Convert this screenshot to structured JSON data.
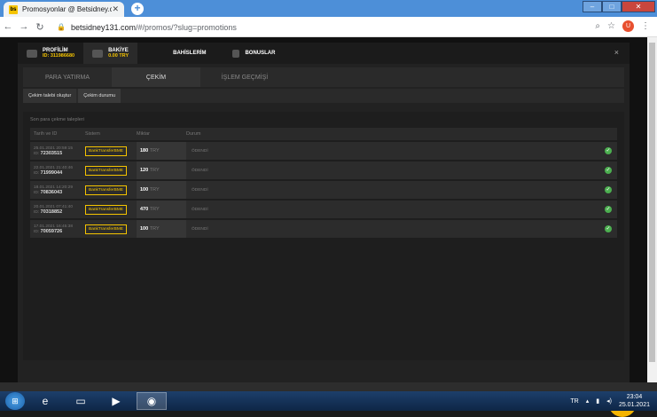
{
  "browser": {
    "tab_title": "Promosyonlar @ Betsidney.com",
    "tab_favicon": "bs",
    "url_host": "betsidney131.com",
    "url_path": "/#/promos/?slug=promotions",
    "profile_initial": "U"
  },
  "modal": {
    "profile_label": "PROFİLİM",
    "profile_id": "ID: 311986680",
    "balance_label": "BAKİYE",
    "balance_value": "0.00 TRY",
    "bets_label": "BAHİSLERİM",
    "bonus_label": "BONUSLAR",
    "close": "×",
    "tabs": [
      "PARA YATIRMA",
      "ÇEKİM",
      "İŞLEM GEÇMİŞİ"
    ],
    "pills": [
      "Çekim talebi oluştur",
      "Çekim durumu"
    ],
    "section_title": "Son para çekme talepleri",
    "columns": [
      "Tarih ve ID",
      "Sistem",
      "Miktar",
      "Durum"
    ],
    "rows": [
      {
        "date": "25.01.2021 20:59:15",
        "id_prefix": "ID:",
        "id": "72303515",
        "system": "BankTransferBME",
        "amount": "180",
        "currency": "TRY",
        "status": "ÖDENDİ"
      },
      {
        "date": "22.01.2021 21:40:46",
        "id_prefix": "ID:",
        "id": "71999044",
        "system": "BankTransferBME",
        "amount": "120",
        "currency": "TRY",
        "status": "ÖDENDİ"
      },
      {
        "date": "18.01.2021 14:20:29",
        "id_prefix": "ID:",
        "id": "70836043",
        "system": "BankTransferBME",
        "amount": "100",
        "currency": "TRY",
        "status": "ÖDENDİ"
      },
      {
        "date": "20.01.2021 07:41:40",
        "id_prefix": "ID:",
        "id": "70318852",
        "system": "BankTransferBME",
        "amount": "470",
        "currency": "TRY",
        "status": "ÖDENDİ"
      },
      {
        "date": "17.01.2021 16:45:38",
        "id_prefix": "ID:",
        "id": "70059726",
        "system": "BankTransferBME",
        "amount": "100",
        "currency": "TRY",
        "status": "ÖDENDİ"
      }
    ]
  },
  "taskbar": {
    "lang": "TR",
    "time": "23:04",
    "date": "25.01.2021"
  },
  "colors": {
    "accent": "#f5c400",
    "success": "#4caf50",
    "background": "#111111"
  }
}
